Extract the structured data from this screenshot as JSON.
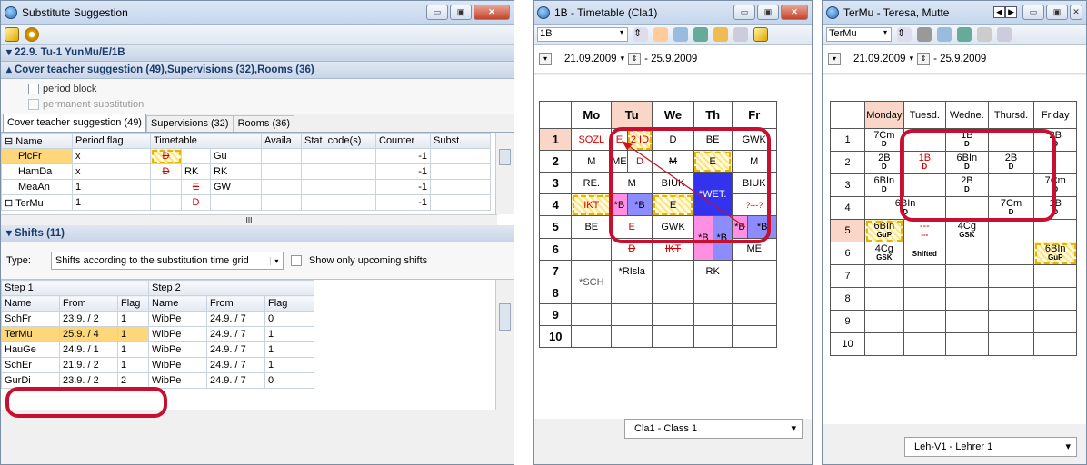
{
  "win1": {
    "title": "Substitute Suggestion",
    "date_header": "▾ 22.9. Tu-1 YunMu/E/1B",
    "cover_header": "▴ Cover teacher suggestion (49),Supervisions (32),Rooms (36)",
    "cb_period_block": "period block",
    "cb_permanent": "permanent substitution",
    "tabs": [
      "Cover teacher suggestion (49)",
      "Supervisions (32)",
      "Rooms (36)"
    ],
    "cols": [
      "Name",
      "Period flag",
      "Timetable",
      "Availa",
      "Stat. code(s)",
      "Counter",
      "Subst."
    ],
    "rows": [
      {
        "name": "PicFr",
        "flag": "x",
        "t1": "D",
        "t2": "",
        "t3": "Gu",
        "counter": "-1"
      },
      {
        "name": "HamDa",
        "flag": "x",
        "t1": "D",
        "t2": "RK",
        "t3": "RK",
        "counter": "-1"
      },
      {
        "name": "MeaAn",
        "flag": "1",
        "t1": "",
        "t2": "E",
        "t3": "GW",
        "counter": "-1"
      },
      {
        "name": "TerMu",
        "flag": "1",
        "t1": "",
        "t2": "D",
        "t3": "",
        "counter": "-1"
      }
    ],
    "scroll_glyph": "III",
    "shifts_header": "▾ Shifts (11)",
    "type_label": "Type:",
    "type_value": "Shifts according to the substitution time grid",
    "cb_upcoming": "Show only upcoming shifts",
    "step1": "Step 1",
    "step2": "Step 2",
    "shift_cols": [
      "Name",
      "From",
      "Flag",
      "Name",
      "From",
      "Flag"
    ],
    "shift_rows": [
      [
        "SchFr",
        "23.9. / 2",
        "1",
        "WibPe",
        "24.9. / 7",
        "0"
      ],
      [
        "TerMu",
        "25.9. / 4",
        "1",
        "WibPe",
        "24.9. / 7",
        "1"
      ],
      [
        "HauGe",
        "24.9. / 1",
        "1",
        "WibPe",
        "24.9. / 7",
        "1"
      ],
      [
        "SchEr",
        "21.9. / 2",
        "1",
        "WibPe",
        "24.9. / 7",
        "1"
      ],
      [
        "GurDi",
        "23.9. / 2",
        "2",
        "WibPe",
        "24.9. / 7",
        "0"
      ]
    ]
  },
  "win2": {
    "title": "1B -  Timetable (Cla1)",
    "selector": "1B",
    "date_from": "21.09.2009",
    "date_to": "- 25.9.2009",
    "days": [
      "Mo",
      "Tu",
      "We",
      "Th",
      "Fr"
    ],
    "periods": [
      "1",
      "2",
      "3",
      "4",
      "5",
      "6",
      "7",
      "8",
      "9",
      "10"
    ],
    "c": {
      "p1mo": "SOZL",
      "p1tu1": "E",
      "p1tu2": "2 ID",
      "p1we": "D",
      "p1th": "BE",
      "p1fr": "GWK",
      "p2mo": "M",
      "p2tu1": "ME",
      "p2tu2": "D",
      "p2we": "M",
      "p2th": "E",
      "p2fr": "M",
      "p3mo": "RE.",
      "p3tu": "M",
      "p3we": "BIUK",
      "p3th": "*WET.",
      "p3fr": "BIUK",
      "p4mo": "IKT",
      "p4tu1": "*B",
      "p4tu2": "*B",
      "p4we": "E",
      "p4fr": "?---?",
      "p5mo": "BE",
      "p5tu": "E",
      "p5we": "GWK",
      "p5th1": "*B",
      "p5th2": "*B",
      "p5fr1": "*B",
      "p5fr2": "*B",
      "p6tu": "D",
      "p6we": "IKT",
      "p6fr": "ME",
      "p7mo": "*SCH",
      "p7tu": "*RIsla",
      "p7th": "RK"
    },
    "status": "Cla1 - Class 1"
  },
  "win3": {
    "title": "TerMu - Teresa, Mutte",
    "selector": "TerMu",
    "date_from": "21.09.2009",
    "date_to": "- 25.9.2009",
    "days": [
      "Monday",
      "Tuesd.",
      "Wedne.",
      "Thursd.",
      "Friday"
    ],
    "periods": [
      "1",
      "2",
      "3",
      "4",
      "5",
      "6",
      "7",
      "8",
      "9",
      "10"
    ],
    "c": {
      "p1mo": "7Cm",
      "p1mo_s": "D",
      "p1we": "1B",
      "p1we_s": "D",
      "p1fr": "2B",
      "p1fr_s": "D",
      "p2mo": "2B",
      "p2mo_s": "D",
      "p2tu": "1B",
      "p2tu_s": "D",
      "p2we": "6BIn",
      "p2we_s": "D",
      "p2th": "2B",
      "p2th_s": "D",
      "p3mo": "6BIn",
      "p3mo_s": "D",
      "p3we": "2B",
      "p3we_s": "D",
      "p3fr": "7Cm",
      "p3fr_s": "D",
      "p4tu": "6BIn",
      "p4tu_s": "D",
      "p4th": "7Cm",
      "p4th_s": "D",
      "p4fr": "1B",
      "p4fr_s": "D",
      "p5mo": "6BIn",
      "p5mo_s": "GuP",
      "p5tu": "---",
      "p5tu_s": "---",
      "p5we": "4Cg",
      "p5we_s": "GSK",
      "p6mo": "4Cg",
      "p6mo_s": "GSK",
      "p6tu": "Shifted",
      "p6fr": "6BIn",
      "p6fr_s": "GuP"
    },
    "status": "Leh-V1 - Lehrer 1"
  }
}
